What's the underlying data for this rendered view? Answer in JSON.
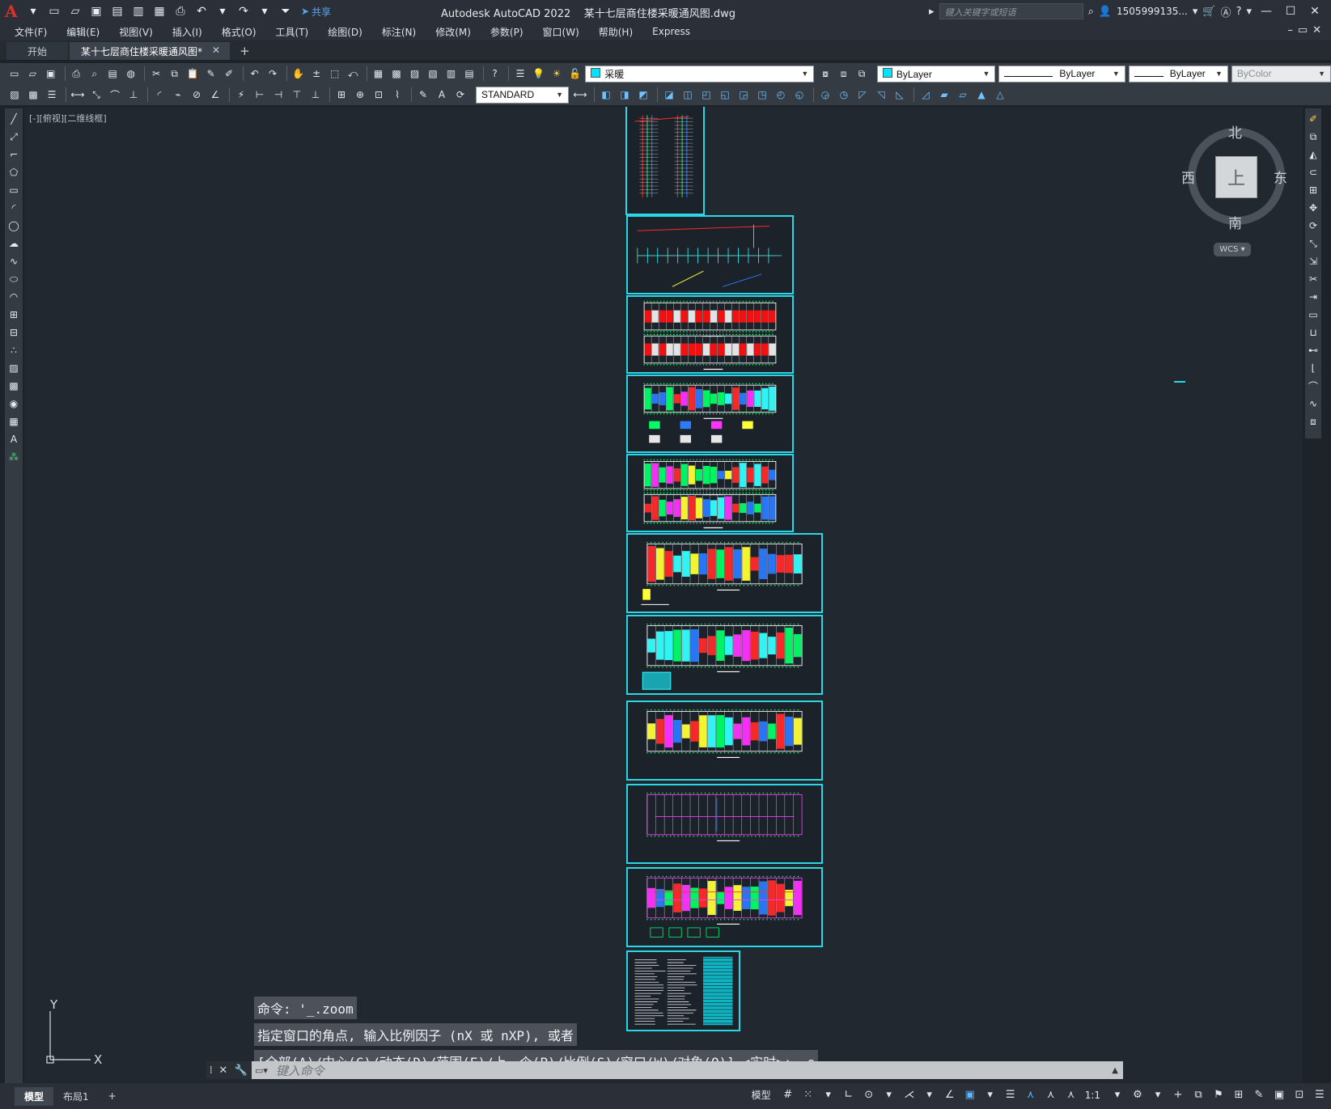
{
  "titlebar": {
    "app_name": "Autodesk AutoCAD 2022",
    "file_name": "某十七层商住楼采暖通风图.dwg",
    "share_label": "共享",
    "search_placeholder": "键入关键字或短语",
    "user": "1505999135...",
    "logo": "A"
  },
  "menu": {
    "items": [
      "文件(F)",
      "编辑(E)",
      "视图(V)",
      "插入(I)",
      "格式(O)",
      "工具(T)",
      "绘图(D)",
      "标注(N)",
      "修改(M)",
      "参数(P)",
      "窗口(W)",
      "帮助(H)",
      "Express"
    ]
  },
  "tabs": {
    "start": "开始",
    "active": "某十七层商住楼采暖通风图*",
    "add": "+"
  },
  "properties": {
    "layer": "采暖",
    "layer_color": "#00e5ff",
    "color": "ByLayer",
    "color_swatch": "#00e5ff",
    "linetype": "ByLayer",
    "lineweight": "ByLayer",
    "plotstyle": "ByColor",
    "textstyle": "STANDARD"
  },
  "viewport": {
    "label": "[-][俯视][二维线框]"
  },
  "viewcube": {
    "north": "北",
    "south": "南",
    "east": "东",
    "west": "西",
    "face": "上",
    "wcs": "WCS"
  },
  "ucs": {
    "x": "X",
    "y": "Y"
  },
  "command": {
    "history": [
      "命令: '_.zoom",
      "指定窗口的角点, 输入比例因子 (nX 或 nXP), 或者",
      "[全部(A)/中心(C)/动态(D)/范围(E)/上一个(P)/比例(S)/窗口(W)/对象(O)] <实时>: _e"
    ],
    "placeholder": "键入命令"
  },
  "status": {
    "layout_tabs": [
      "模型",
      "布局1"
    ],
    "add": "+",
    "model_label": "模型",
    "scale": "1:1"
  },
  "colors": {
    "sheet_frame": "#2ad7e6",
    "background": "#212830",
    "accent": "#5db6ff"
  }
}
